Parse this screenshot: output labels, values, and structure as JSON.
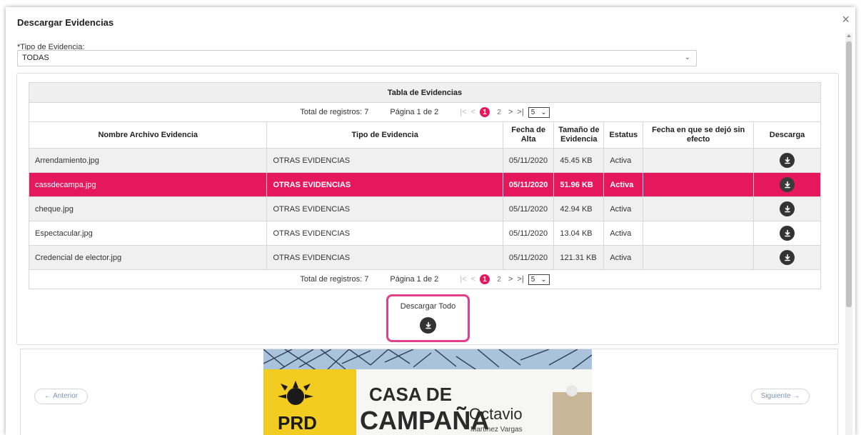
{
  "modal": {
    "title": "Descargar Evidencias",
    "close": "×"
  },
  "filter": {
    "label": "*Tipo de Evidencia:",
    "value": "TODAS"
  },
  "table": {
    "caption": "Tabla de Evidencias",
    "columns": [
      "Nombre Archivo Evidencia",
      "Tipo de Evidencia",
      "Fecha de Alta",
      "Tamaño de Evidencia",
      "Estatus",
      "Fecha en que se dejó sin efecto",
      "Descarga"
    ],
    "rows": [
      {
        "name": "Arrendamiento.jpg",
        "type": "OTRAS EVIDENCIAS",
        "date": "05/11/2020",
        "size": "45.45 KB",
        "status": "Activa",
        "void_date": ""
      },
      {
        "name": "cassdecampa.jpg",
        "type": "OTRAS EVIDENCIAS",
        "date": "05/11/2020",
        "size": "51.96 KB",
        "status": "Activa",
        "void_date": ""
      },
      {
        "name": "cheque.jpg",
        "type": "OTRAS EVIDENCIAS",
        "date": "05/11/2020",
        "size": "42.94 KB",
        "status": "Activa",
        "void_date": ""
      },
      {
        "name": "Espectacular.jpg",
        "type": "OTRAS EVIDENCIAS",
        "date": "05/11/2020",
        "size": "13.04 KB",
        "status": "Activa",
        "void_date": ""
      },
      {
        "name": "Credencial de elector.jpg",
        "type": "OTRAS EVIDENCIAS",
        "date": "05/11/2020",
        "size": "121.31 KB",
        "status": "Activa",
        "void_date": ""
      }
    ],
    "selected_row": 1
  },
  "pager": {
    "total": "Total de registros: 7",
    "page_info": "Página 1 de 2",
    "first": "|<",
    "prev": "<",
    "pages": [
      "1",
      "2"
    ],
    "current_page": "1",
    "next": ">",
    "last": ">|",
    "page_size": "5"
  },
  "download_all": {
    "label": "Descargar Todo"
  },
  "viewer": {
    "prev": "← Anterior",
    "next": "Siguiente →",
    "photo_text": {
      "logo": "PRD",
      "line1": "CASA DE",
      "line2": "CAMPAÑA",
      "name": "Octavio",
      "surname": "Martínez Vargas"
    }
  },
  "colors": {
    "accent": "#e5185d",
    "highlight_border": "#e0408a",
    "icon": "#333333"
  }
}
